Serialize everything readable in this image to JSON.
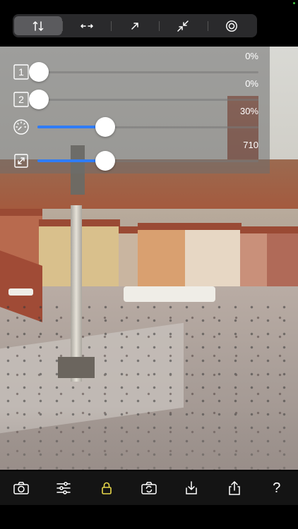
{
  "colors": {
    "accent": "#2f7cf6",
    "lock_active": "#e8d84a",
    "toolbar_bg": "#2a2a2c"
  },
  "top_toolbar": {
    "segments": [
      {
        "icon": "vertical-arrows-icon",
        "active": true
      },
      {
        "icon": "horizontal-arrows-icon",
        "active": false
      },
      {
        "icon": "diagonal-arrow-icon",
        "active": false
      },
      {
        "icon": "converging-arrows-icon",
        "active": false
      },
      {
        "icon": "target-icon",
        "active": false
      }
    ]
  },
  "sliders": [
    {
      "id": "1",
      "icon": "box-1-icon",
      "label": "1",
      "value_text": "0%",
      "value": 0
    },
    {
      "id": "2",
      "icon": "box-2-icon",
      "label": "2",
      "value_text": "0%",
      "value": 0
    },
    {
      "id": "speed",
      "icon": "speedometer-icon",
      "value_text": "30%",
      "value": 0.3
    },
    {
      "id": "size",
      "icon": "resize-icon",
      "value_text": "710",
      "value": 0.3
    }
  ],
  "bottom_toolbar": {
    "buttons": [
      {
        "icon": "camera-icon"
      },
      {
        "icon": "sliders-icon"
      },
      {
        "icon": "lock-icon"
      },
      {
        "icon": "camera-rotate-icon"
      },
      {
        "icon": "download-icon"
      },
      {
        "icon": "share-icon"
      },
      {
        "icon": "help-icon",
        "label": "?"
      }
    ]
  }
}
